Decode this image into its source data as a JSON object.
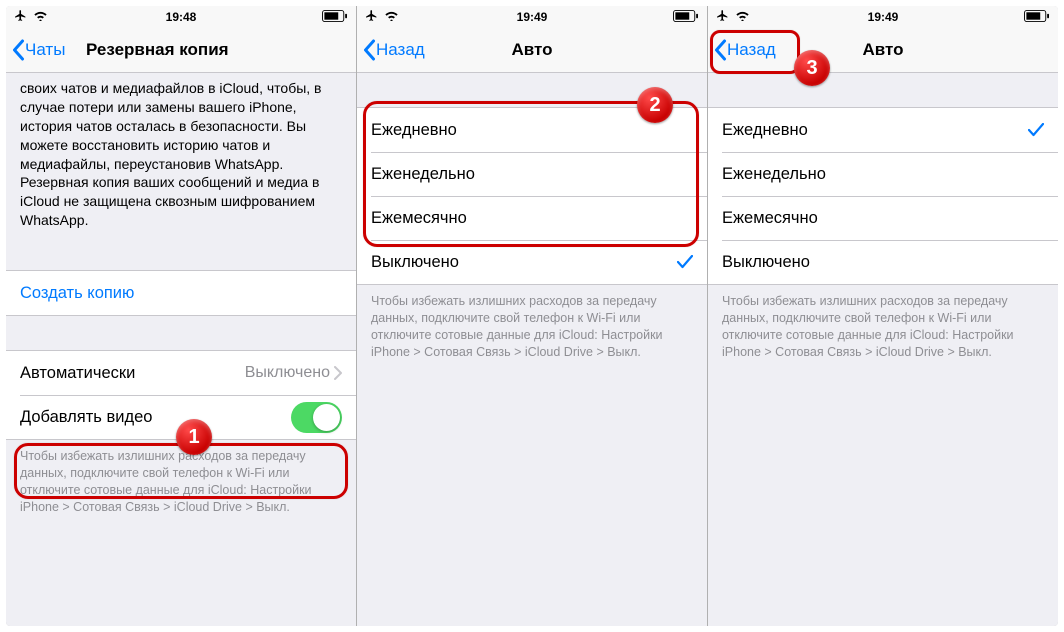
{
  "phone1": {
    "status_time": "19:48",
    "back_label": "Чаты",
    "title": "Резервная копия",
    "description": "своих чатов и медиафайлов в iCloud, чтобы, в случае потери или замены вашего iPhone, история чатов осталась в безопасности. Вы можете восстановить историю чатов и медиафайлы, переустановив WhatsApp. Резервная копия ваших сообщений и медиа в iCloud не защищена сквозным шифрованием WhatsApp.",
    "create_copy": "Создать копию",
    "auto_row_label": "Автоматически",
    "auto_row_value": "Выключено",
    "video_row_label": "Добавлять видео",
    "video_toggle_on": true,
    "footer": "Чтобы избежать излишних расходов за передачу данных, подключите свой телефон к Wi-Fi или отключите сотовые данные для iCloud: Настройки iPhone > Сотовая Связь > iCloud Drive > Выкл.",
    "badge": "1"
  },
  "phone2": {
    "status_time": "19:49",
    "back_label": "Назад",
    "title": "Авто",
    "options": {
      "daily": "Ежедневно",
      "weekly": "Еженедельно",
      "monthly": "Ежемесячно",
      "off": "Выключено"
    },
    "selected": "off",
    "footer": "Чтобы избежать излишних расходов за передачу данных, подключите свой телефон к Wi-Fi или отключите сотовые данные для iCloud: Настройки iPhone > Сотовая Связь > iCloud Drive > Выкл.",
    "badge": "2"
  },
  "phone3": {
    "status_time": "19:49",
    "back_label": "Назад",
    "title": "Авто",
    "options": {
      "daily": "Ежедневно",
      "weekly": "Еженедельно",
      "monthly": "Ежемесячно",
      "off": "Выключено"
    },
    "selected": "daily",
    "footer": "Чтобы избежать излишних расходов за передачу данных, подключите свой телефон к Wi-Fi или отключите сотовые данные для iCloud: Настройки iPhone > Сотовая Связь > iCloud Drive > Выкл.",
    "badge": "3"
  }
}
